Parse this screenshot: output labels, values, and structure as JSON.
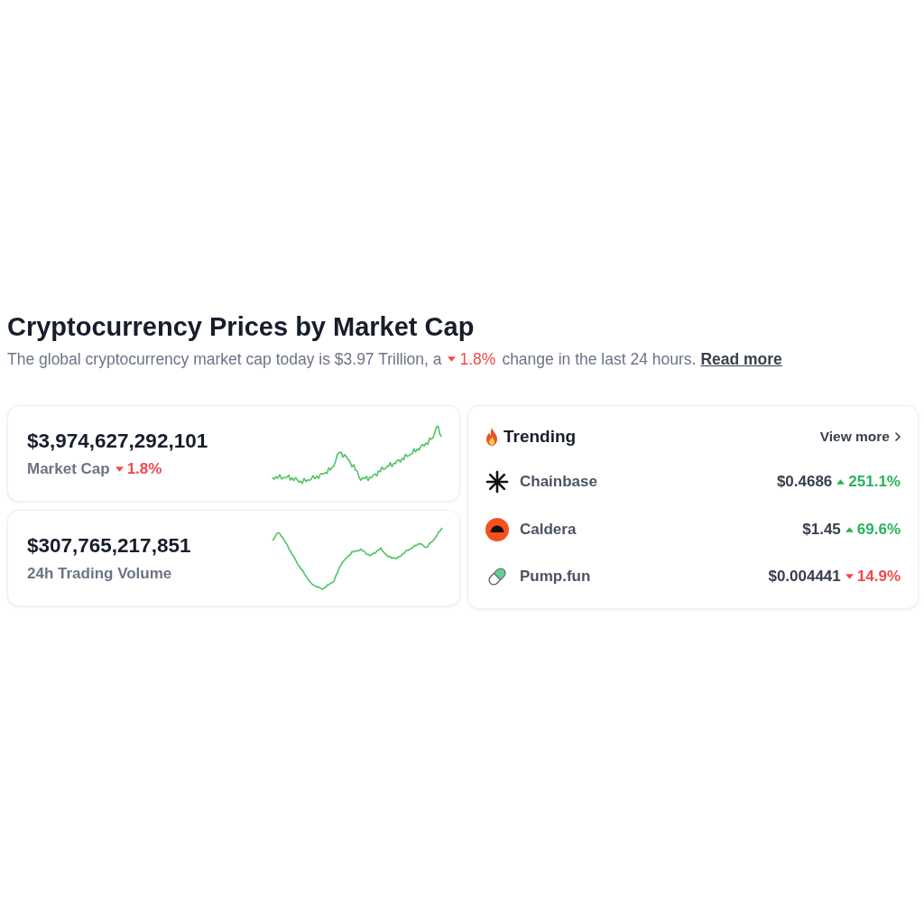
{
  "header": {
    "title": "Cryptocurrency Prices by Market Cap",
    "summary": {
      "before": "The global cryptocurrency market cap today is $3.97 Trillion, a",
      "change": {
        "negative": true,
        "value": "1.8%"
      },
      "after": "change in the last 24 hours.",
      "link": "Read more"
    }
  },
  "stats": [
    {
      "value": "$3,974,627,292,101",
      "label": "Market Cap",
      "change": {
        "negative": true,
        "value": "1.8%"
      }
    },
    {
      "value": "$307,765,217,851",
      "label": "24h Trading Volume"
    }
  ],
  "trending": {
    "title": "Trending",
    "view_more": "View more",
    "coins": [
      {
        "name": "Chainbase",
        "price": "$0.4686",
        "change": {
          "negative": false,
          "value": "251.1%"
        }
      },
      {
        "name": "Caldera",
        "price": "$1.45",
        "change": {
          "negative": false,
          "value": "69.6%"
        }
      },
      {
        "name": "Pump.fun",
        "price": "$0.004441",
        "change": {
          "negative": true,
          "value": "14.9%"
        }
      }
    ]
  }
}
